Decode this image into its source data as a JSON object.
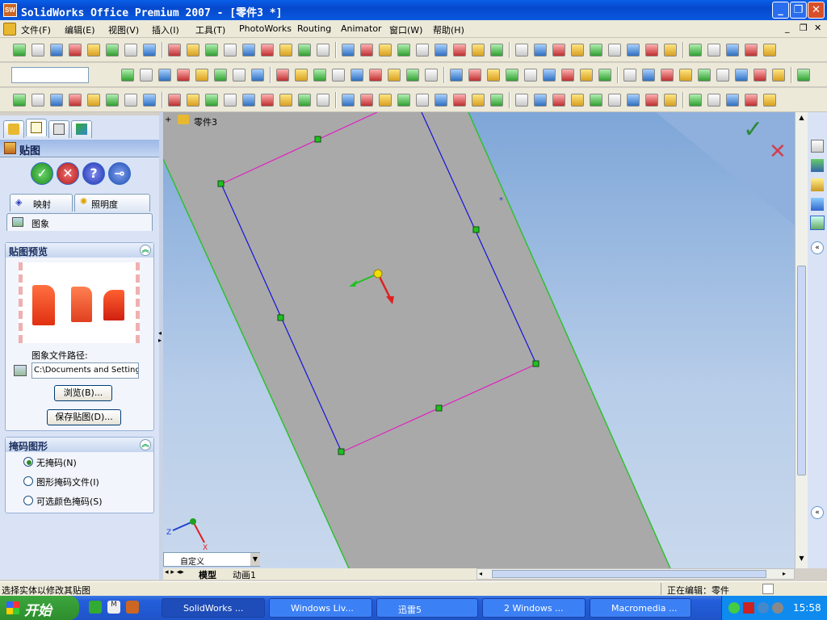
{
  "window": {
    "title": "SolidWorks Office Premium 2007 - [零件3 *]",
    "app_icon": "sw-icon"
  },
  "menubar": {
    "items": [
      "文件(F)",
      "编辑(E)",
      "视图(V)",
      "插入(I)",
      "工具(T)",
      "PhotoWorks",
      "Routing",
      "Animator",
      "窗口(W)",
      "帮助(H)"
    ]
  },
  "property_manager": {
    "title": "贴图",
    "tabs": [
      "映射",
      "照明度",
      "图象"
    ],
    "preview_group": {
      "title": "贴图预览",
      "path_label": "图象文件路径:",
      "path_value": "C:\\Documents and Settings",
      "browse": "浏览(B)...",
      "save": "保存贴图(D)..."
    },
    "mask_group": {
      "title": "掩码图形",
      "options": [
        {
          "label": "无掩码(N)",
          "selected": true
        },
        {
          "label": "图形掩码文件(I)",
          "selected": false
        },
        {
          "label": "可选颜色掩码(S)",
          "selected": false
        }
      ]
    }
  },
  "viewport": {
    "tree_label": "零件3",
    "view_combo": "自定义",
    "tabs": [
      "模型",
      "动画1"
    ],
    "axis_labels": [
      "Z",
      "X"
    ]
  },
  "status": {
    "left": "选择实体以修改其贴图",
    "right": "正在编辑：零件"
  },
  "taskbar": {
    "start": "开始",
    "buttons": [
      "SolidWorks ...",
      "Windows Liv...",
      "迅雷5",
      "2 Windows ...",
      "Macromedia ..."
    ],
    "clock": "15:58"
  },
  "colors": {
    "accent": "#0a5ee8",
    "sketch_blue": "#1414d8",
    "sketch_pink": "#e020c0",
    "point_green": "#20a020",
    "face_gray": "#a9a9a9"
  }
}
